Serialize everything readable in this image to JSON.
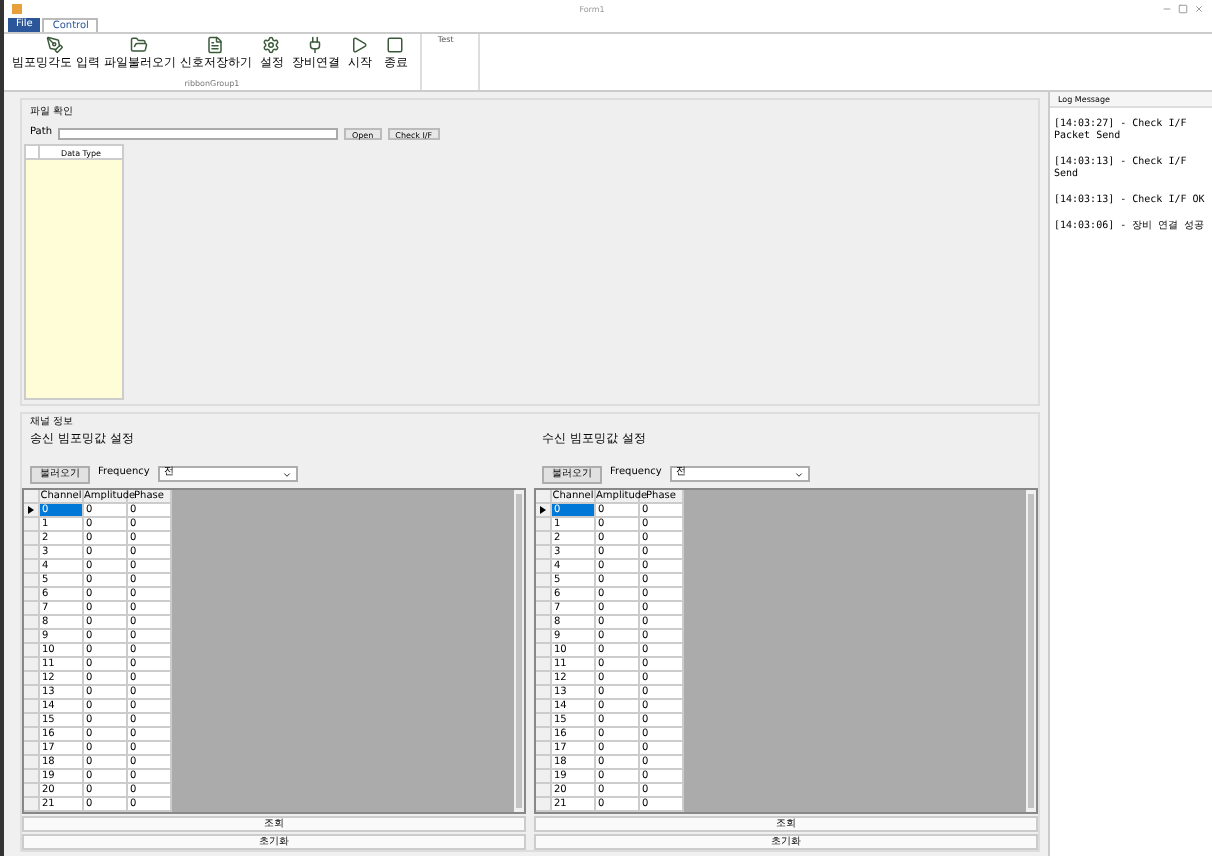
{
  "window": {
    "title": "Form1"
  },
  "ribbon_tabs": [
    {
      "label": "File",
      "selected": false,
      "kind": "file"
    },
    {
      "label": "Control",
      "selected": true,
      "kind": "tab"
    }
  ],
  "ribbon_groups": [
    {
      "name": "ribbonGroup1",
      "buttons": [
        {
          "label": "빔포밍각도 입력"
        },
        {
          "label": "파일불러오기"
        },
        {
          "label": "신호저장하기"
        },
        {
          "label": "설정"
        },
        {
          "label": "장비연결"
        },
        {
          "label": "시작"
        },
        {
          "label": "종료"
        }
      ]
    },
    {
      "title": "Test"
    }
  ],
  "file_panel": {
    "title": "파일 확인",
    "path_label": "Path",
    "buttons": [
      "Open",
      "Check I/F"
    ],
    "grid_columns": [
      "Data Type"
    ]
  },
  "channel_panel": {
    "title": "채널 정보",
    "sides": [
      {
        "title": "송신 빔포밍값 설정",
        "load_button": "불러오기",
        "frequency_label": "Frequency",
        "frequency_value": "전",
        "columns": [
          "Channel",
          "Amplitude",
          "Phase"
        ],
        "rows": [
          {
            "channel": "0",
            "amplitude": "0",
            "phase": "0",
            "selected": true
          },
          {
            "channel": "1",
            "amplitude": "0",
            "phase": "0",
            "selected": false
          },
          {
            "channel": "2",
            "amplitude": "0",
            "phase": "0",
            "selected": false
          },
          {
            "channel": "3",
            "amplitude": "0",
            "phase": "0",
            "selected": false
          },
          {
            "channel": "4",
            "amplitude": "0",
            "phase": "0",
            "selected": false
          },
          {
            "channel": "5",
            "amplitude": "0",
            "phase": "0",
            "selected": false
          },
          {
            "channel": "6",
            "amplitude": "0",
            "phase": "0",
            "selected": false
          },
          {
            "channel": "7",
            "amplitude": "0",
            "phase": "0",
            "selected": false
          },
          {
            "channel": "8",
            "amplitude": "0",
            "phase": "0",
            "selected": false
          },
          {
            "channel": "9",
            "amplitude": "0",
            "phase": "0",
            "selected": false
          },
          {
            "channel": "10",
            "amplitude": "0",
            "phase": "0",
            "selected": false
          },
          {
            "channel": "11",
            "amplitude": "0",
            "phase": "0",
            "selected": false
          },
          {
            "channel": "12",
            "amplitude": "0",
            "phase": "0",
            "selected": false
          },
          {
            "channel": "13",
            "amplitude": "0",
            "phase": "0",
            "selected": false
          },
          {
            "channel": "14",
            "amplitude": "0",
            "phase": "0",
            "selected": false
          },
          {
            "channel": "15",
            "amplitude": "0",
            "phase": "0",
            "selected": false
          },
          {
            "channel": "16",
            "amplitude": "0",
            "phase": "0",
            "selected": false
          },
          {
            "channel": "17",
            "amplitude": "0",
            "phase": "0",
            "selected": false
          },
          {
            "channel": "18",
            "amplitude": "0",
            "phase": "0",
            "selected": false
          },
          {
            "channel": "19",
            "amplitude": "0",
            "phase": "0",
            "selected": false
          },
          {
            "channel": "20",
            "amplitude": "0",
            "phase": "0",
            "selected": false
          },
          {
            "channel": "21",
            "amplitude": "0",
            "phase": "0",
            "selected": false
          }
        ],
        "buttons": [
          "조회",
          "초기화"
        ]
      },
      {
        "title": "수신 빔포밍값 설정",
        "load_button": "불러오기",
        "frequency_label": "Frequency",
        "frequency_value": "전",
        "columns": [
          "Channel",
          "Amplitude",
          "Phase"
        ],
        "rows": [
          {
            "channel": "0",
            "amplitude": "0",
            "phase": "0",
            "selected": true
          },
          {
            "channel": "1",
            "amplitude": "0",
            "phase": "0",
            "selected": false
          },
          {
            "channel": "2",
            "amplitude": "0",
            "phase": "0",
            "selected": false
          },
          {
            "channel": "3",
            "amplitude": "0",
            "phase": "0",
            "selected": false
          },
          {
            "channel": "4",
            "amplitude": "0",
            "phase": "0",
            "selected": false
          },
          {
            "channel": "5",
            "amplitude": "0",
            "phase": "0",
            "selected": false
          },
          {
            "channel": "6",
            "amplitude": "0",
            "phase": "0",
            "selected": false
          },
          {
            "channel": "7",
            "amplitude": "0",
            "phase": "0",
            "selected": false
          },
          {
            "channel": "8",
            "amplitude": "0",
            "phase": "0",
            "selected": false
          },
          {
            "channel": "9",
            "amplitude": "0",
            "phase": "0",
            "selected": false
          },
          {
            "channel": "10",
            "amplitude": "0",
            "phase": "0",
            "selected": false
          },
          {
            "channel": "11",
            "amplitude": "0",
            "phase": "0",
            "selected": false
          },
          {
            "channel": "12",
            "amplitude": "0",
            "phase": "0",
            "selected": false
          },
          {
            "channel": "13",
            "amplitude": "0",
            "phase": "0",
            "selected": false
          },
          {
            "channel": "14",
            "amplitude": "0",
            "phase": "0",
            "selected": false
          },
          {
            "channel": "15",
            "amplitude": "0",
            "phase": "0",
            "selected": false
          },
          {
            "channel": "16",
            "amplitude": "0",
            "phase": "0",
            "selected": false
          },
          {
            "channel": "17",
            "amplitude": "0",
            "phase": "0",
            "selected": false
          },
          {
            "channel": "18",
            "amplitude": "0",
            "phase": "0",
            "selected": false
          },
          {
            "channel": "19",
            "amplitude": "0",
            "phase": "0",
            "selected": false
          },
          {
            "channel": "20",
            "amplitude": "0",
            "phase": "0",
            "selected": false
          },
          {
            "channel": "21",
            "amplitude": "0",
            "phase": "0",
            "selected": false
          }
        ],
        "buttons": [
          "조회",
          "초기화"
        ]
      }
    ]
  },
  "log_panel": {
    "title": "Log Message",
    "entries": [
      "[14:03:27] - Check I/F Packet Send",
      "[14:03:13] - Check I/F Send",
      "[14:03:13] - Check I/F OK",
      "[14:03:06] - 장비 연결 성공"
    ]
  }
}
